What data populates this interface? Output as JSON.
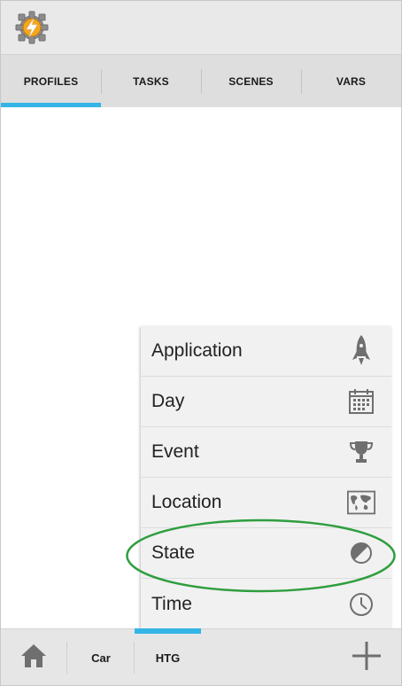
{
  "app": {
    "icon": "tasker-gear-lightning-icon"
  },
  "tabs": [
    {
      "label": "PROFILES",
      "active": true
    },
    {
      "label": "TASKS",
      "active": false
    },
    {
      "label": "SCENES",
      "active": false
    },
    {
      "label": "VARS",
      "active": false
    }
  ],
  "menu": {
    "items": [
      {
        "label": "Application",
        "icon": "rocket-icon"
      },
      {
        "label": "Day",
        "icon": "calendar-icon"
      },
      {
        "label": "Event",
        "icon": "trophy-icon"
      },
      {
        "label": "Location",
        "icon": "map-icon"
      },
      {
        "label": "State",
        "icon": "half-circle-icon",
        "highlighted": true
      },
      {
        "label": "Time",
        "icon": "clock-icon"
      }
    ]
  },
  "bottom": {
    "home_icon": "home-icon",
    "projects": [
      {
        "label": "Car"
      },
      {
        "label": "HTG",
        "active": true
      }
    ],
    "add_icon": "plus-icon"
  },
  "colors": {
    "accent": "#33b5e5",
    "highlight_ellipse": "#2e9e3e"
  }
}
